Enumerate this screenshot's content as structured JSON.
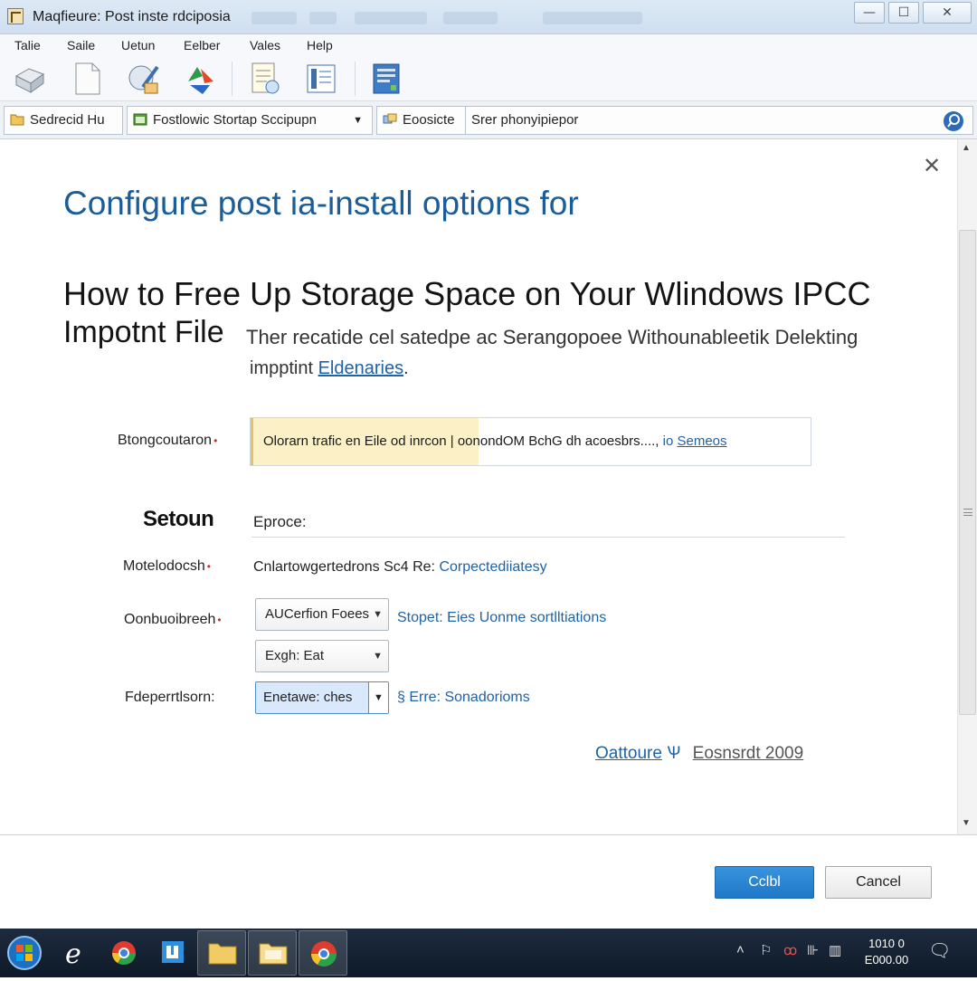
{
  "window": {
    "title": "Maqfieure: Post inste rdciposia",
    "controls": {
      "minimize": "—",
      "maximize": "☐",
      "close": "✕"
    }
  },
  "menu": [
    "Talie",
    "Saile",
    "Uetun",
    "Eelber",
    "Vales",
    "Help"
  ],
  "toolbar": {
    "icons": [
      "box-icon",
      "document-icon",
      "paint-icon",
      "recycle-icon",
      "notepad-icon",
      "list-document-icon",
      "report-icon"
    ]
  },
  "address_bar": {
    "crumb1": "Sedrecid Hu",
    "crumb2": "Fostlowic Stortap Sccipupn",
    "crumb3_label": "Eoosicte",
    "search_text": "Srer phonyipiepor"
  },
  "dialog": {
    "close_glyph": "✕",
    "heading": "Configure post ia-install options for",
    "article_title_line1": "How to Free Up Storage Space on Your Wlindows IPCC",
    "article_title_line2": "Impotnt File",
    "description_line1": "Ther recatide cel satedpe ac Serangopoee Withounableetik Delekting",
    "description_line2_prefix": "impptint",
    "description_line2_link": "Eldenaries",
    "description_line2_suffix": ".",
    "info_label": "Btongcoutaron",
    "info_text": "Olorarn trafic en Eile od inrcon | oonondOM BchG dh acoesbrs....,",
    "info_link_prefix": "io",
    "info_link": "Semeos",
    "section_title": "Setoun",
    "section_sub": "Eproce:",
    "row1_label": "Motelodocsh",
    "row1_value": "Cnlartowgertedrons Sc4 Re:",
    "row1_link": "Corpectediiatesy",
    "row2_label": "Oonbuoibreeh",
    "row2_select": "AUCerfion Foees",
    "row2_link": "Stopet: Eies Uonme sortlltiations",
    "row2_select2": "Exgh: Eat",
    "row3_label": "Fdeperrtlsorn:",
    "row3_select": "Enetawe: ches",
    "row3_link": "§ Erre: Sonadorioms",
    "footer_link1": "Oattoure",
    "footer_link1_glyph": "Ѱ",
    "footer_link2": "Eosnsrdt 2009"
  },
  "buttons": {
    "primary": "Cclbl",
    "cancel": "Cancel"
  },
  "taskbar": {
    "apps": [
      "start-orb",
      "internet-explorer-icon",
      "chrome-icon",
      "store-icon",
      "folder-icon",
      "folder-icon",
      "chrome-icon"
    ],
    "clock_time": "1010 0",
    "clock_date": "E000.00"
  },
  "colors": {
    "accent": "#1a5d99",
    "link": "#1f62a6",
    "primary_button": "#2683d2",
    "taskbar": "#16222f",
    "info_highlight": "#fcf1c6"
  }
}
